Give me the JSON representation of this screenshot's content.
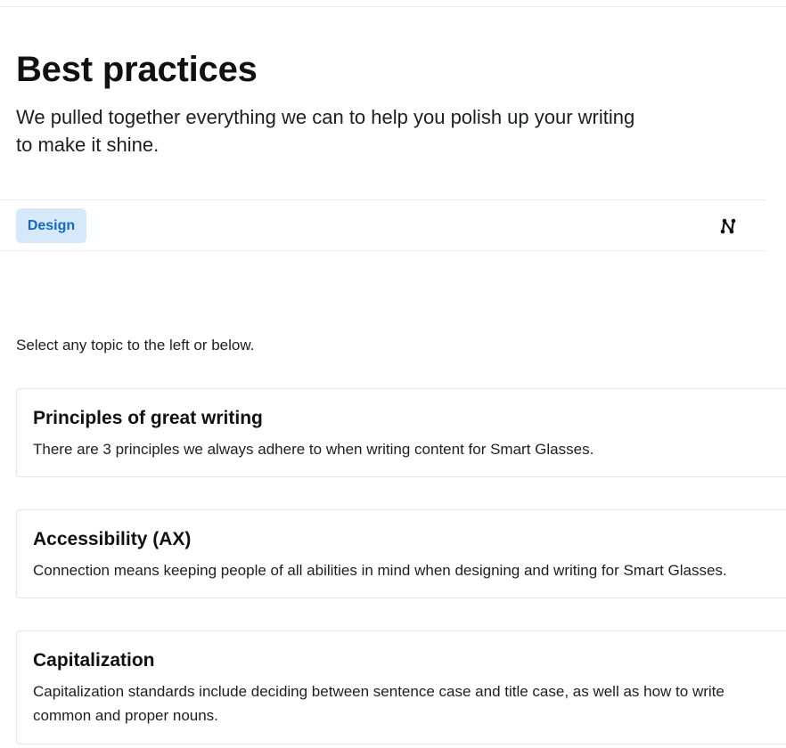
{
  "header": {
    "title": "Best practices",
    "subtitle": "We pulled together everything we can to help you polish up your writing to make it shine."
  },
  "toolbar": {
    "tag_label": "Design",
    "icon": "graph-nodes-icon"
  },
  "intro_text": "Select any topic to the left or below.",
  "cards": [
    {
      "title": "Principles of great writing",
      "description_lines": [
        "There are 3 principles we always adhere to when writing content for Smart Glasses."
      ]
    },
    {
      "title": "Accessibility (AX)",
      "description_lines": [
        "Connection means keeping people of all abilities in mind when designing and writing for Smart Glasses."
      ]
    },
    {
      "title": "Capitalization",
      "description_lines": [
        "Capitalization standards include deciding between sentence case and title case, as well as how to write",
        "common and proper nouns."
      ]
    }
  ],
  "colors": {
    "tag_background": "#d6e9fb",
    "tag_text": "#1667c1",
    "border": "#e4e6e8"
  }
}
